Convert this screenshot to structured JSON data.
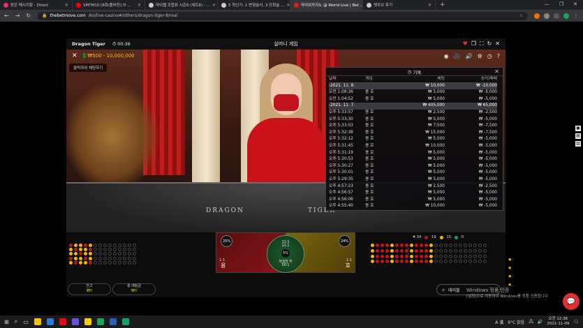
{
  "browser": {
    "tabs": [
      {
        "label": "받은 메시지함 - Direct",
        "color": "#e1306c",
        "active": false
      },
      {
        "label": "SMTM10 [8화/풀버전] 쓰 ...",
        "color": "#ff0000",
        "active": false
      },
      {
        "label": "마이웹 조합표 시즌6 (세트8) - ...",
        "color": "#cccccc",
        "active": false
      },
      {
        "label": "5 혁신가, 1 변형술사, 3 강화술 ...",
        "color": "#cccccc",
        "active": false
      },
      {
        "label": "라이브카지노 @ World Live | Bet ...",
        "color": "#e02020",
        "active": true
      },
      {
        "label": "벳무브 후기",
        "color": "#cccccc",
        "active": false
      }
    ],
    "new_tab": "+",
    "url_domain": "thebetmove.com",
    "url_path": "/ko/live-casino#/others/dragon-tiger-8/real"
  },
  "game": {
    "title": "Dragon Tiger",
    "timer": "00:36",
    "mode": "실머니 게임",
    "limit": "₩500 - 10,000,000",
    "click_tip": "클릭하여 채팅하기",
    "table_left": "DRAGON",
    "table_right": "TIGER"
  },
  "history": {
    "title": "기록",
    "headers": [
      "날짜",
      "게임",
      "베팅",
      "승리/패배"
    ],
    "rows": [
      {
        "date": "-2021. 11. 8.",
        "game": "",
        "bet": "₩ 10,000",
        "result": "₩ -10,000",
        "sep": true
      },
      {
        "date": "오전 1:08:36",
        "game": "용 호",
        "bet": "₩ 5,000",
        "result": "₩ -5,000",
        "sep": false
      },
      {
        "date": "오전 1:04:52",
        "game": "용 호",
        "bet": "₩ 5,000",
        "result": "₩ -5,000",
        "sep": false
      },
      {
        "date": "-2021. 11. 7.",
        "game": "",
        "bet": "₩ 405,000",
        "result": "₩ 65,000",
        "sep": true
      },
      {
        "date": "오후 5:33:57",
        "game": "용 호",
        "bet": "₩ 2,500",
        "result": "₩ -2,500",
        "sep": false
      },
      {
        "date": "오후 5:33:30",
        "game": "용 호",
        "bet": "₩ 5,000",
        "result": "₩ -5,000",
        "sep": false
      },
      {
        "date": "오후 5:33:03",
        "game": "용 호",
        "bet": "₩ 7,500",
        "result": "₩ -7,500",
        "sep": false
      },
      {
        "date": "오후 5:32:38",
        "game": "용 호",
        "bet": "₩ 15,000",
        "result": "₩ -7,500",
        "sep": false
      },
      {
        "date": "오후 5:32:12",
        "game": "용 호",
        "bet": "₩ 5,000",
        "result": "₩ -5,000",
        "sep": false
      },
      {
        "date": "오후 5:31:45",
        "game": "용 호",
        "bet": "₩ 10,000",
        "result": "₩ -5,000",
        "sep": false
      },
      {
        "date": "오후 5:31:19",
        "game": "용 호",
        "bet": "₩ 5,000",
        "result": "₩ -5,000",
        "sep": false
      },
      {
        "date": "오후 5:30:53",
        "game": "용 호",
        "bet": "₩ 5,000",
        "result": "₩ -5,000",
        "sep": false
      },
      {
        "date": "오후 5:30:27",
        "game": "용 호",
        "bet": "₩ 5,000",
        "result": "₩ -5,000",
        "sep": false
      },
      {
        "date": "오후 5:30:01",
        "game": "용 호",
        "bet": "₩ 5,000",
        "result": "₩ -5,000",
        "sep": false
      },
      {
        "date": "오후 5:29:35",
        "game": "용 호",
        "bet": "₩ 5,000",
        "result": "₩ -5,000",
        "sep": false
      },
      {
        "date": "오후 4:57:23",
        "game": "용 호",
        "bet": "₩ 2,500",
        "result": "₩ -2,500",
        "sep": false
      },
      {
        "date": "오후 4:56:57",
        "game": "용 호",
        "bet": "₩ 5,000",
        "result": "₩ -5,000",
        "sep": false
      },
      {
        "date": "오후 4:56:06",
        "game": "용 호",
        "bet": "₩ 5,000",
        "result": "₩ -5,000",
        "sep": false
      },
      {
        "date": "오후 4:55:40",
        "game": "용 호",
        "bet": "₩ 10,000",
        "result": "₩ -5,000",
        "sep": false
      }
    ]
  },
  "betting": {
    "dragon_pct": "25%",
    "tiger_pct": "24%",
    "dragon_label": "용",
    "tiger_label": "호",
    "dragon_odds": "1:1",
    "tiger_odds": "1:1",
    "tie_line1": "11:1",
    "tie_line2": "11:1",
    "tie_pct": "5%",
    "tie_name": "적정한 무",
    "tie_odds": "50:1",
    "balance_label": "잔고",
    "balance_value": "₩0",
    "total_bet_label": "총 베팅금",
    "total_bet_value": "₩0",
    "tables_label": "테이블",
    "stats": {
      "rounds": "# 34",
      "dragon": "19",
      "tiger": "15",
      "tie": "0"
    }
  },
  "windows": {
    "watermark_line1": "Windows 정품 인증",
    "watermark_line2": "[설정]으로 이동하여 Windows를 정품 인증합니다.",
    "weather": "9°C 맑음",
    "time": "오전 12:36",
    "date": "2021-11-09",
    "ime": "A 漢"
  }
}
